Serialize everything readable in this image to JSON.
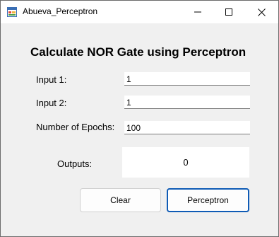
{
  "window": {
    "title": "Abueva_Perceptron",
    "controls": [
      "minimize-icon",
      "maximize-icon",
      "close-icon"
    ]
  },
  "form": {
    "heading": "Calculate NOR Gate using Perceptron",
    "input1_label": "Input 1:",
    "input1_value": "1",
    "input2_label": "Input 2:",
    "input2_value": "1",
    "epochs_label": "Number of Epochs:",
    "epochs_value": "100",
    "outputs_label": "Outputs:",
    "outputs_value": "0"
  },
  "buttons": {
    "clear": "Clear",
    "perceptron": "Perceptron"
  },
  "colors": {
    "focus_border": "#0f5bb5",
    "background": "#f0f0f0"
  }
}
